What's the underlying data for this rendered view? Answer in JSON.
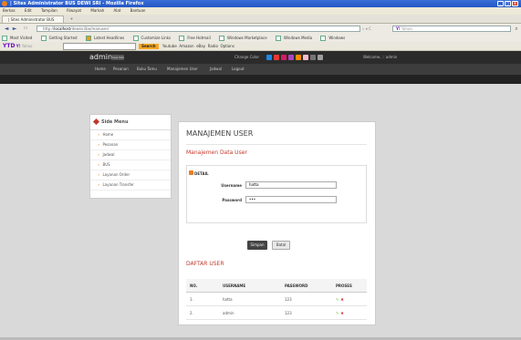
{
  "browser": {
    "title": "| Sites Administrator BUS DEWI SRI - Mozilla Firefox",
    "menu": [
      "Berkas",
      "Edit",
      "Tampilan",
      "Riwayat",
      "Markah",
      "Alat",
      "Bantuan"
    ],
    "tab_title": "| Sites Administrator BUS DEWI SRI",
    "url_prefix": "http://",
    "url_host": "localhost",
    "url_path": "/dewisri/bo/manuser/",
    "search_placeholder": "Yahoo",
    "bookmarks": [
      "Most Visited",
      "Getting Started",
      "Latest Headlines",
      "Customize Links",
      "Free Hotmail",
      "Windows Marketplace",
      "Windows Media",
      "Windows"
    ],
    "toolbar_logo": "YTD",
    "toolbar_search_placeholder": "Yahoo",
    "toolbar_items": [
      "Search",
      "Youtube",
      "Amazon",
      "eBay",
      "Radio",
      "Options"
    ]
  },
  "site": {
    "brand": "admin",
    "view_site": "View Site",
    "change_color_label": "Change Color",
    "swatch_colors": [
      "#1e88e5",
      "#e53935",
      "#d81b60",
      "#ab47bc",
      "#fb8c00",
      "#f8bbd0",
      "#757575",
      "#9e9e9e"
    ],
    "welcome": "Welcome, :: admin",
    "nav": [
      "Home",
      "Pesanan",
      "Buku Tamu",
      "Manajemen User",
      "Jadwal",
      "Logout"
    ]
  },
  "sidebar": {
    "title": "Side Menu",
    "items": [
      "Home",
      "Pesanan",
      "Jadwal",
      "BUS",
      "Layanan Order",
      "Layanan Transfer"
    ]
  },
  "main": {
    "title": "MANAJEMEN USER",
    "subtitle": "Manajemen Data User",
    "detail_label": "DETAIL",
    "username_label": "Username",
    "username_value": "hatta",
    "password_label": "Password",
    "password_value": "•••",
    "save_label": "Simpan",
    "cancel_label": "Batal",
    "list_title": "DAFTAR USER",
    "columns": [
      "NO.",
      "USERNAME",
      "PASSWORD",
      "PROSES"
    ],
    "rows": [
      {
        "no": "1.",
        "username": "hatta",
        "password": "123"
      },
      {
        "no": "2.",
        "username": "admin",
        "password": "123"
      }
    ]
  }
}
